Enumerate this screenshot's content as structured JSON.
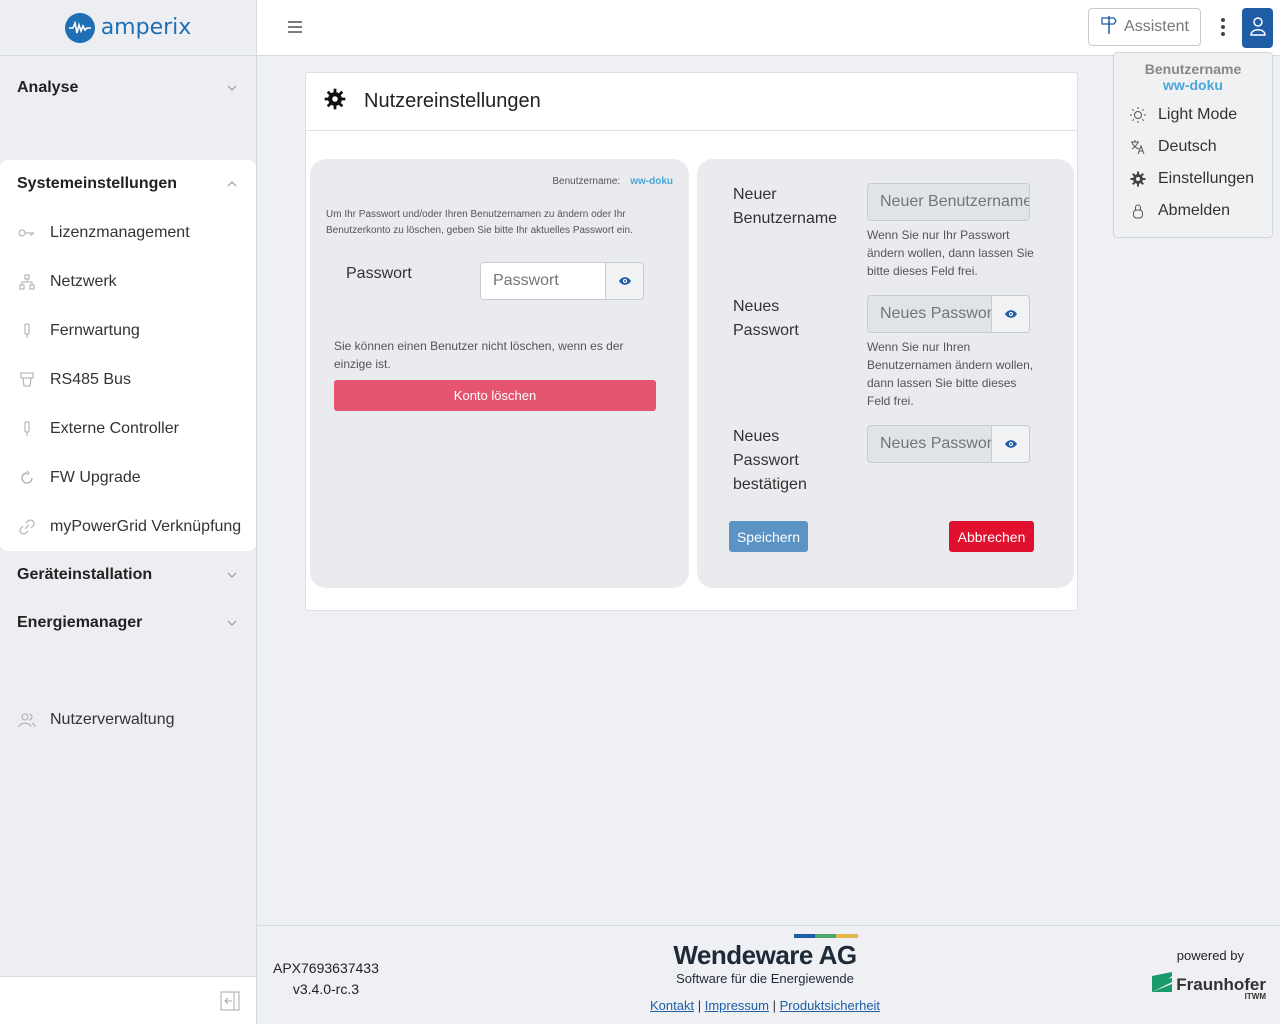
{
  "app": {
    "logo_text": "amperix"
  },
  "sidebar": {
    "sections": [
      {
        "label": "Analyse"
      },
      {
        "label": "Systemeinstellungen"
      },
      {
        "label": "Geräteinstallation"
      },
      {
        "label": "Energiemanager"
      }
    ],
    "items": [
      {
        "label": "Lizenzmanagement",
        "icon": "key-icon"
      },
      {
        "label": "Netzwerk",
        "icon": "network-icon"
      },
      {
        "label": "Fernwartung",
        "icon": "plug-icon"
      },
      {
        "label": "RS485 Bus",
        "icon": "connector-icon"
      },
      {
        "label": "Externe Controller",
        "icon": "plug-icon"
      },
      {
        "label": "FW Upgrade",
        "icon": "refresh-icon"
      },
      {
        "label": "myPowerGrid Verknüpfung",
        "icon": "link-icon"
      }
    ],
    "user_management": "Nutzerverwaltung"
  },
  "topbar": {
    "assistant_label": "Assistent"
  },
  "user_menu": {
    "name_label": "Benutzername",
    "name_value": "ww-doku",
    "items": [
      {
        "label": "Light Mode",
        "icon": "sun-icon"
      },
      {
        "label": "Deutsch",
        "icon": "translate-icon"
      },
      {
        "label": "Einstellungen",
        "icon": "gear-icon"
      },
      {
        "label": "Abmelden",
        "icon": "lock-icon"
      }
    ]
  },
  "page": {
    "title": "Nutzereinstellungen",
    "left": {
      "username_label": "Benutzername:",
      "username_value": "ww-doku",
      "help": "Um Ihr Passwort und/oder Ihren Benutzernamen zu ändern oder Ihr Benutzerkonto zu löschen, geben Sie bitte Ihr aktuelles Passwort ein.",
      "password_label": "Passwort",
      "password_placeholder": "Passwort",
      "delete_note": "Sie können einen Benutzer nicht löschen, wenn es der einzige ist.",
      "delete_button": "Konto löschen"
    },
    "right": {
      "new_username_label": "Neuer Benutzername",
      "new_username_placeholder": "Neuer Benutzername",
      "new_username_hint": "Wenn Sie nur Ihr Passwort ändern wollen, dann lassen Sie bitte dieses Feld frei.",
      "new_password_label": "Neues Passwort",
      "new_password_placeholder": "Neues Passwort",
      "new_password_hint": "Wenn Sie nur Ihren Benutzernamen ändern wollen, dann lassen Sie bitte dieses Feld frei.",
      "confirm_password_label": "Neues Passwort bestätigen",
      "confirm_password_placeholder": "Neues Passwort",
      "save_button": "Speichern",
      "cancel_button": "Abbrechen"
    }
  },
  "footer": {
    "serial": "APX7693637433",
    "version": "v3.4.0-rc.3",
    "brand_name": "Wendeware AG",
    "brand_sub": "Software für die Energiewende",
    "links": [
      "Kontakt",
      "Impressum",
      "Produktsicherheit"
    ],
    "powered_by": "powered by",
    "partner": "Fraunhofer",
    "partner_sub": "ITWM"
  },
  "colors": {
    "accent": "#1f5ea6",
    "danger": "#e0102e",
    "delete": "#e5556f",
    "highlight": "#4aa6d9"
  }
}
